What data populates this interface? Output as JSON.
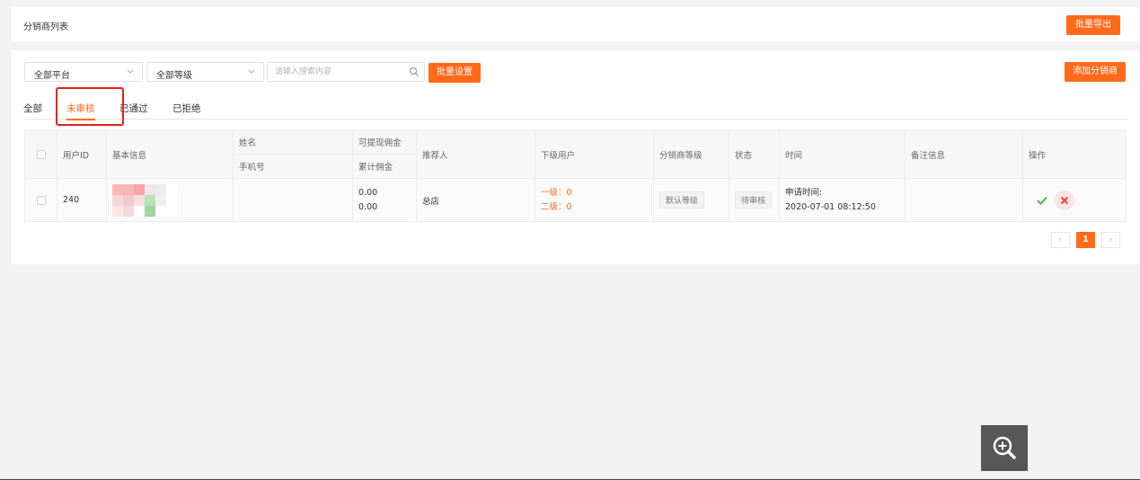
{
  "header": {
    "title": "分销商列表",
    "export_button": "批量导出"
  },
  "filters": {
    "platform_select": "全部平台",
    "level_select": "全部等级",
    "search_placeholder": "请输入搜索内容",
    "batch_settings_button": "批量设置",
    "add_distributor_button": "添加分销商"
  },
  "tabs": [
    {
      "label": "全部",
      "active": false
    },
    {
      "label": "未审核",
      "active": true
    },
    {
      "label": "已通过",
      "active": false
    },
    {
      "label": "已拒绝",
      "active": false
    }
  ],
  "table": {
    "headers": {
      "user_id": "用户ID",
      "basic_info": "基本信息",
      "name": "姓名",
      "phone": "手机号",
      "withdrawable": "可提现佣金",
      "total": "累计佣金",
      "referrer": "推荐人",
      "sub_users": "下级用户",
      "level": "分销商等级",
      "status": "状态",
      "time": "时间",
      "remark": "备注信息",
      "actions": "操作"
    },
    "rows": [
      {
        "user_id": "240",
        "name": "",
        "phone": "",
        "withdrawable": "0.00",
        "total": "0.00",
        "referrer": "总店",
        "level1": "一级：0",
        "level2": "二级：0",
        "level": "默认等级",
        "status": "待审核",
        "time_label": "申请时间:",
        "time_value": "2020-07-01 08:12:50",
        "remark": ""
      }
    ]
  },
  "pagination": {
    "prev": "‹",
    "current": "1",
    "next": "›"
  },
  "icons": {
    "approve": "check-icon",
    "reject": "close-icon",
    "zoom": "zoom-in-icon"
  },
  "colors": {
    "accent": "#ff6a1a",
    "approve": "#3dbb3d",
    "reject": "#e8474c",
    "highlight": "#e8201a"
  }
}
